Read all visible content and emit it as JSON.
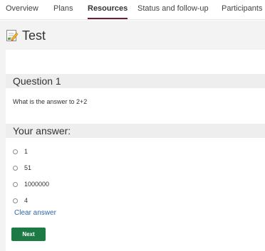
{
  "tabs": [
    {
      "label": "Overview"
    },
    {
      "label": "Plans"
    },
    {
      "label": "Resources",
      "active": true
    },
    {
      "label": "Status and follow-up"
    },
    {
      "label": "Participants"
    }
  ],
  "test": {
    "title": "Test",
    "icon": "test-edit-icon"
  },
  "question": {
    "header": "Question 1",
    "text": "What is the answer to 2+2"
  },
  "answer": {
    "header": "Your answer:",
    "options": [
      {
        "label": "1"
      },
      {
        "label": "51"
      },
      {
        "label": "1000000"
      },
      {
        "label": "4"
      }
    ],
    "clear_label": "Clear answer"
  },
  "actions": {
    "next_label": "Next"
  },
  "colors": {
    "active_tab_underline": "#6b1d3c",
    "link": "#2b66a8",
    "primary_button": "#1e7a45"
  }
}
